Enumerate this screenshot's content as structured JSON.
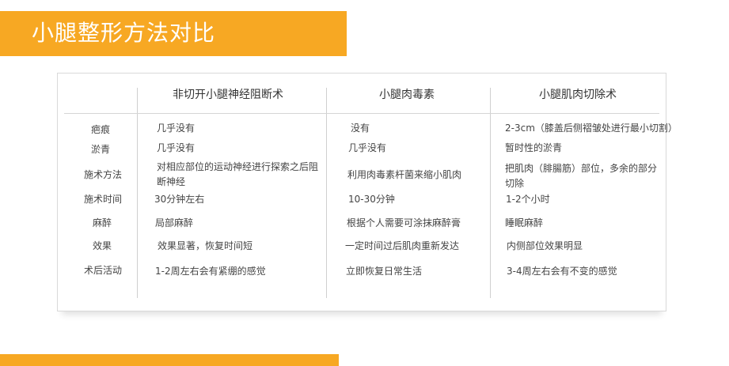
{
  "title": "小腿整形方法对比",
  "columns": [
    "非切开小腿神经阻断术",
    "小腿肉毒素",
    "小腿肌肉切除术"
  ],
  "rows": [
    {
      "label": "疤痕",
      "cells": [
        "几乎没有",
        "没有",
        "2-3cm（膝盖后侧褶皱处进行最小切割）"
      ]
    },
    {
      "label": "淤青",
      "cells": [
        "几乎没有",
        "几乎没有",
        "暂时性的淤青"
      ]
    },
    {
      "label": "施术方法",
      "cells": [
        "对相应部位的运动神经进行探索之后阻断神经",
        "利用肉毒素杆菌来缩小肌肉",
        "把肌肉（腓腸筋）部位，多余的部分切除"
      ]
    },
    {
      "label": "施术时间",
      "cells": [
        "30分钟左右",
        "10-30分钟",
        "1-2个小时"
      ]
    },
    {
      "label": "麻醉",
      "cells": [
        "局部麻醉",
        "根据个人需要可涂抹麻醉膏",
        "睡眠麻醉"
      ]
    },
    {
      "label": "效果",
      "cells": [
        "效果显著，恢复时间短",
        "一定时间过后肌肉重新发达",
        "内侧部位效果明显"
      ]
    },
    {
      "label": "术后活动",
      "cells": [
        "1-2周左右会有紧绷的感觉",
        "立即恢复日常生活",
        "3-4周左右会有不变的感觉"
      ]
    }
  ],
  "colors": {
    "accent": "#f7a823",
    "border": "#d9d9d9"
  }
}
